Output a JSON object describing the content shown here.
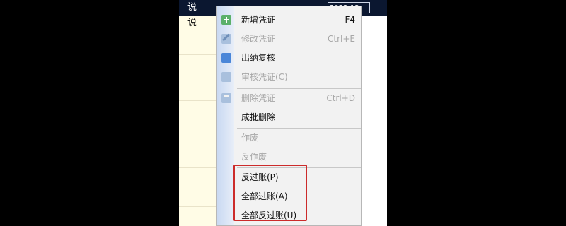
{
  "background": {
    "header_label": "说",
    "side_label": "说",
    "date_text": "2022-12"
  },
  "menu": {
    "items": [
      {
        "label": "新增凭证",
        "shortcut": "F4",
        "icon": "add-icon",
        "enabled": true
      },
      {
        "label": "修改凭证",
        "shortcut": "Ctrl+E",
        "icon": "edit-icon",
        "enabled": false
      },
      {
        "label": "出纳复核",
        "shortcut": "",
        "icon": "cashier-review-icon",
        "enabled": true
      },
      {
        "label": "审核凭证(C)",
        "shortcut": "",
        "icon": "audit-icon",
        "enabled": false
      },
      {
        "label": "删除凭证",
        "shortcut": "Ctrl+D",
        "icon": "delete-icon",
        "enabled": false
      },
      {
        "label": "成批删除",
        "shortcut": "",
        "icon": "",
        "enabled": true
      },
      {
        "label": "作废",
        "shortcut": "",
        "icon": "",
        "enabled": false
      },
      {
        "label": "反作废",
        "shortcut": "",
        "icon": "",
        "enabled": false
      },
      {
        "label": "反过账(P)",
        "shortcut": "",
        "icon": "",
        "enabled": true
      },
      {
        "label": "全部过账(A)",
        "shortcut": "",
        "icon": "",
        "enabled": true
      },
      {
        "label": "全部反过账(U)",
        "shortcut": "",
        "icon": "",
        "enabled": true
      }
    ]
  },
  "colors": {
    "highlight": "#cc2b2b",
    "gutter": "#c9d9f2"
  }
}
